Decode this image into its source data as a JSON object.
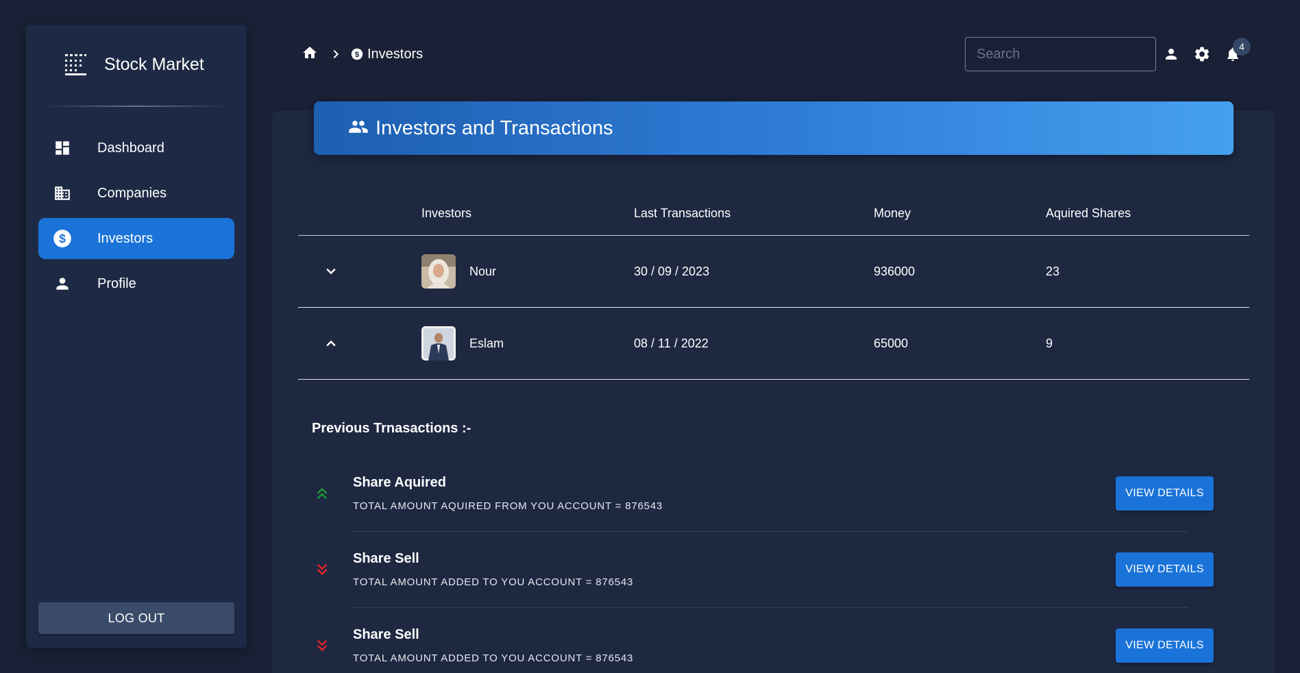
{
  "app": {
    "title": "Stock Market"
  },
  "sidebar": {
    "items": [
      {
        "label": "Dashboard",
        "icon": "dashboard-icon"
      },
      {
        "label": "Companies",
        "icon": "building-icon"
      },
      {
        "label": "Investors",
        "icon": "dollar-circle-icon",
        "active": true
      },
      {
        "label": "Profile",
        "icon": "person-icon"
      }
    ],
    "logout_label": "LOG OUT"
  },
  "breadcrumb": {
    "current": "Investors"
  },
  "search": {
    "placeholder": "Search"
  },
  "notifications": {
    "count": "4"
  },
  "page": {
    "title": "Investors and Transactions"
  },
  "table": {
    "headers": [
      "Investors",
      "Last Transactions",
      "Money",
      "Aquired Shares"
    ],
    "rows": [
      {
        "name": "Nour",
        "date": "30 / 09 / 2023",
        "money": "936000",
        "shares": "23",
        "expanded": false
      },
      {
        "name": "Eslam",
        "date": "08 / 11 / 2022",
        "money": "65000",
        "shares": "9",
        "expanded": true
      }
    ]
  },
  "previous": {
    "title": "Previous Trnasactions :-",
    "items": [
      {
        "title": "Share Aquired",
        "subtitle": "TOTAL AMOUNT AQUIRED FROM YOU ACCOUNT = 876543",
        "type": "up",
        "button": "VIEW DETAILS"
      },
      {
        "title": "Share Sell",
        "subtitle": "TOTAL AMOUNT ADDED TO YOU ACCOUNT = 876543",
        "type": "down",
        "button": "VIEW DETAILS"
      },
      {
        "title": "Share Sell",
        "subtitle": "TOTAL AMOUNT ADDED TO YOU ACCOUNT = 876543",
        "type": "down",
        "button": "VIEW DETAILS"
      }
    ]
  },
  "colors": {
    "background": "#1a2035",
    "accent": "#1a73d8",
    "up": "#1f9d3a",
    "down": "#e0242a"
  }
}
